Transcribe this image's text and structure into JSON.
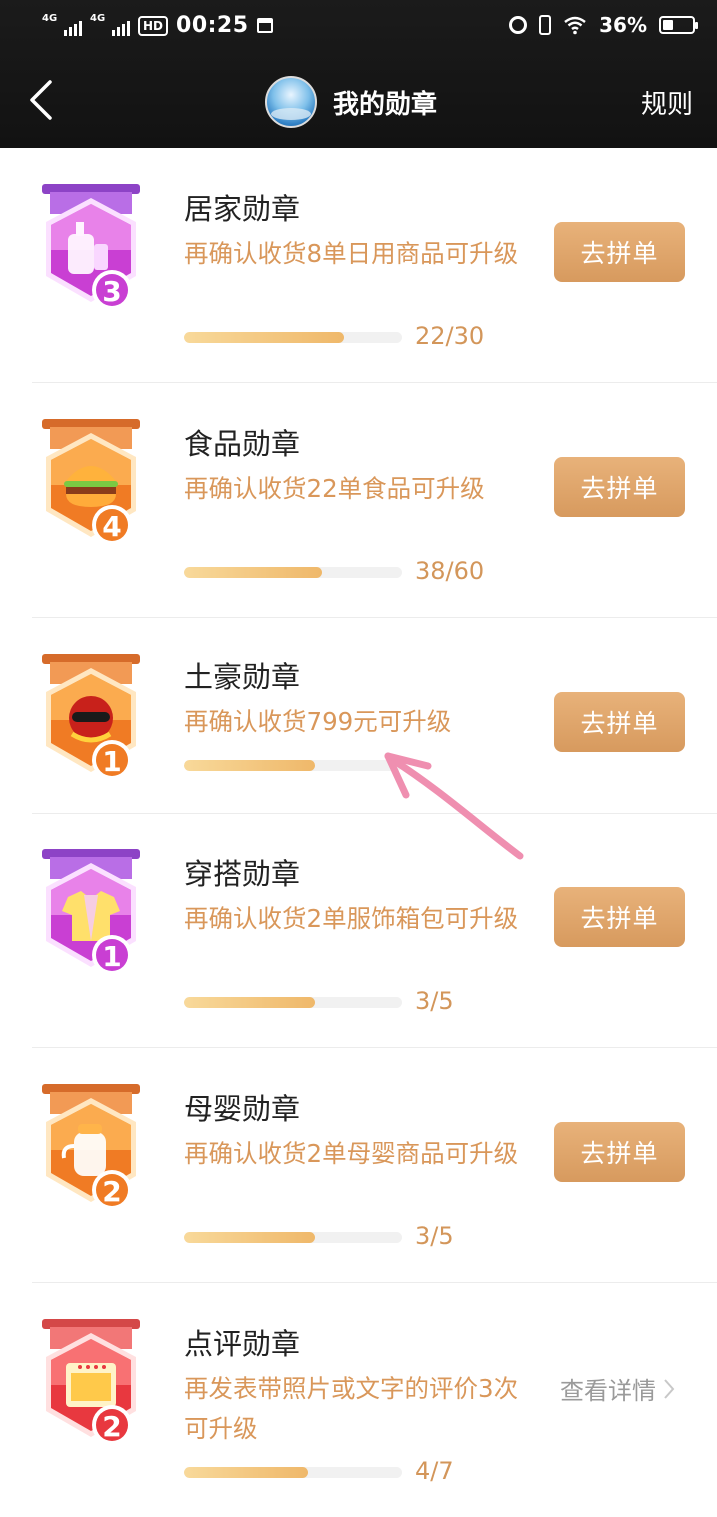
{
  "status_bar": {
    "signal1": "4G",
    "signal2": "4G",
    "hd": "HD",
    "time": "00:25",
    "battery": "36%",
    "battery_level": 0.36
  },
  "header": {
    "title": "我的勋章",
    "rules": "规则"
  },
  "medals": [
    {
      "name": "居家勋章",
      "desc": "再确认收货8单日用商品可升级",
      "progress": "22/30",
      "fraction": 0.733,
      "action": "去拼单",
      "level": "3",
      "theme": "purple",
      "icon": "bottle-icon"
    },
    {
      "name": "食品勋章",
      "desc": "再确认收货22单食品可升级",
      "progress": "38/60",
      "fraction": 0.633,
      "action": "去拼单",
      "level": "4",
      "theme": "orange",
      "icon": "burger-icon"
    },
    {
      "name": "土豪勋章",
      "desc": "再确认收货799元可升级",
      "progress": "",
      "fraction": 0.6,
      "action": "去拼单",
      "level": "1",
      "theme": "orange",
      "icon": "rich-character-icon"
    },
    {
      "name": "穿搭勋章",
      "desc": "再确认收货2单服饰箱包可升级",
      "progress": "3/5",
      "fraction": 0.6,
      "action": "去拼单",
      "level": "1",
      "theme": "purple",
      "icon": "shirt-icon"
    },
    {
      "name": "母婴勋章",
      "desc": "再确认收货2单母婴商品可升级",
      "progress": "3/5",
      "fraction": 0.6,
      "action": "去拼单",
      "level": "2",
      "theme": "orange",
      "icon": "baby-bottle-icon"
    },
    {
      "name": "点评勋章",
      "desc": "再发表带照片或文字的评价3次可升级",
      "progress": "4/7",
      "fraction": 0.571,
      "action": "查看详情",
      "level": "2",
      "theme": "red",
      "icon": "review-photo-icon"
    }
  ],
  "colors": {
    "accent": "#d9975a",
    "button": "#dfa56b",
    "topbar": "#141414"
  }
}
